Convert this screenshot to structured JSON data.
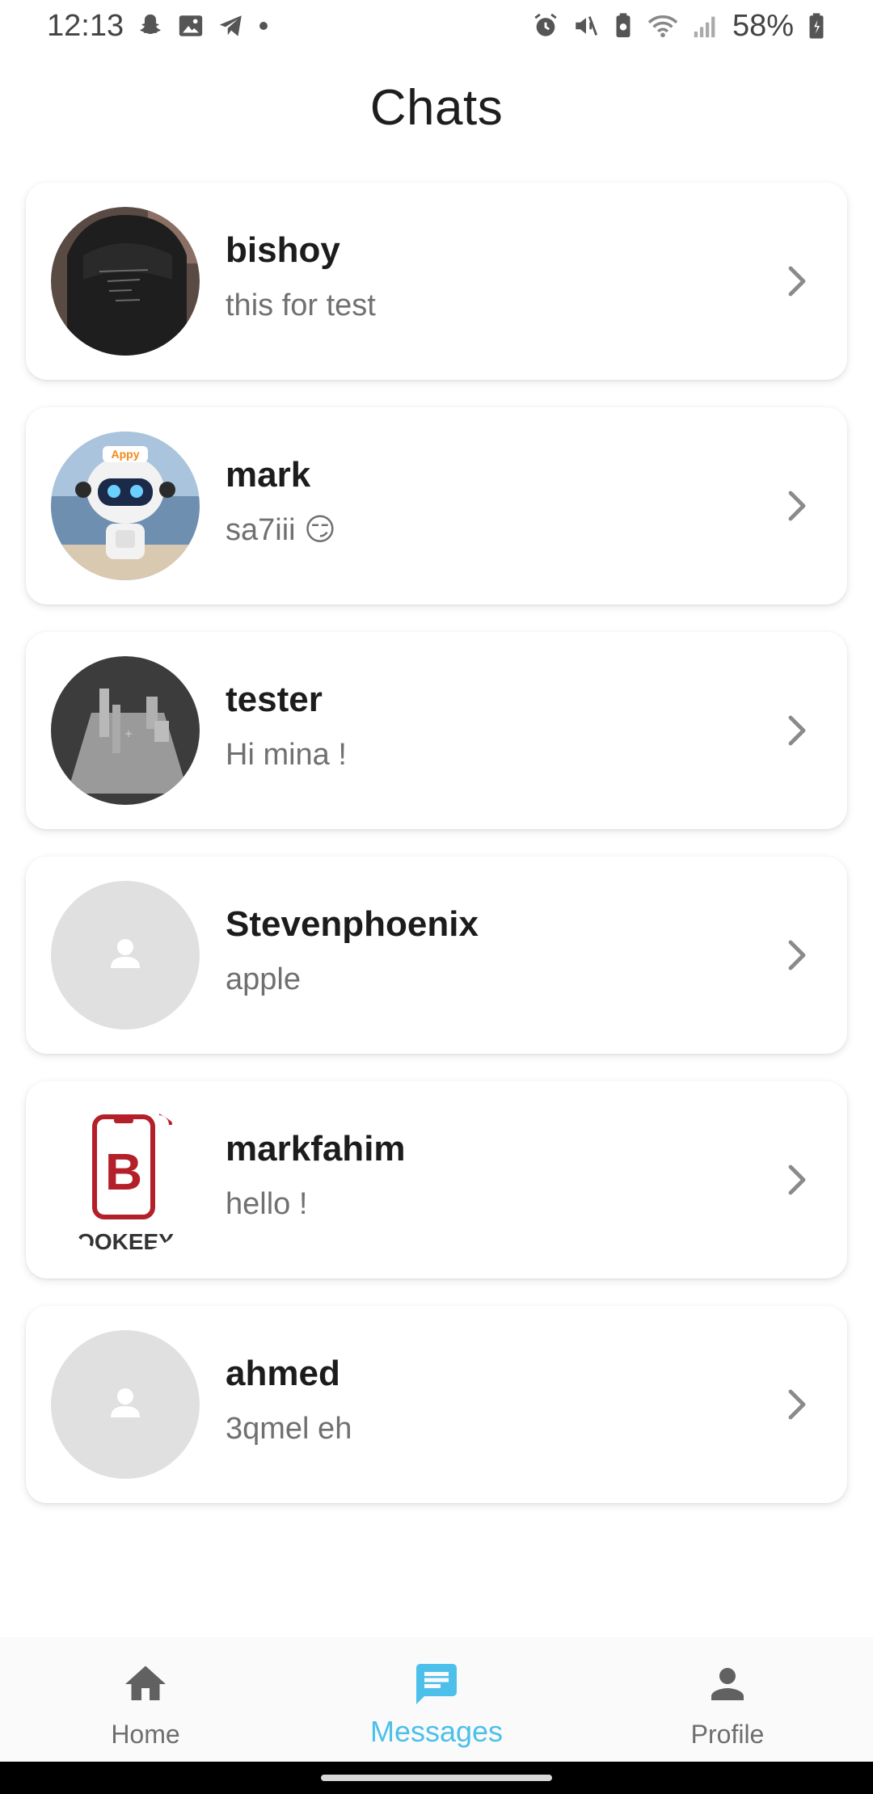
{
  "status_bar": {
    "time": "12:13",
    "battery": "58%",
    "left_icons": [
      "snapchat-icon",
      "gallery-icon",
      "telegram-icon",
      "dot-icon"
    ],
    "right_icons": [
      "alarm-icon",
      "mute-icon",
      "battery-saver-icon",
      "wifi-icon",
      "signal-icon",
      "battery-icon"
    ]
  },
  "page": {
    "title": "Chats"
  },
  "chats": [
    {
      "name": "bishoy",
      "message": "this for test",
      "avatar": "photo-hoodie"
    },
    {
      "name": "mark",
      "message": "sa7iii 😏",
      "avatar": "photo-robot",
      "avatar_text": "Appy"
    },
    {
      "name": "tester",
      "message": "Hi mina !",
      "avatar": "photo-3d-scene"
    },
    {
      "name": "Stevenphoenix",
      "message": "apple",
      "avatar": "placeholder-person"
    },
    {
      "name": "markfahim",
      "message": "hello !",
      "avatar": "logo-bookeey",
      "avatar_text": "OOKEEY"
    },
    {
      "name": "ahmed",
      "message": "3qmel eh",
      "avatar": "placeholder-person"
    }
  ],
  "bottom_nav": {
    "items": [
      {
        "label": "Home",
        "icon": "home-icon"
      },
      {
        "label": "Messages",
        "icon": "chat-icon",
        "active": true
      },
      {
        "label": "Profile",
        "icon": "person-icon"
      }
    ]
  },
  "colors": {
    "accent": "#4cc0ea",
    "text_secondary": "#707070",
    "placeholder": "#e0e0e0"
  }
}
